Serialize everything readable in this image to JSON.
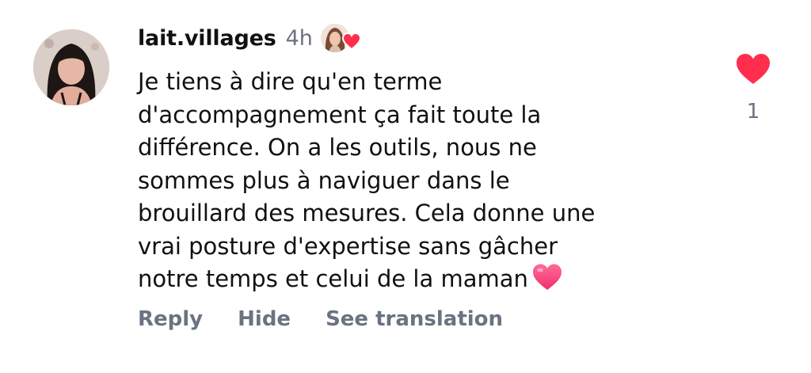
{
  "comment": {
    "username": "lait.villages",
    "time_ago": "4h",
    "text": "Je tiens à dire qu'en terme\nd'accompagnement ça fait toute la\ndifférence. On a les outils, nous ne\nsommes plus à naviguer dans le\nbrouillard des mesures. Cela donne une\nvrai posture d'expertise sans gâcher\nnotre temps et celui de la maman",
    "emoji": "pink-heart-emoji",
    "like_count": "1",
    "liked_by_author": true
  },
  "actions": {
    "reply": "Reply",
    "hide": "Hide",
    "see_translation": "See translation"
  },
  "icons": {
    "like": "heart-icon",
    "liked_by": "creator-liked-heart-icon"
  },
  "colors": {
    "like_red": "#ff2e4c",
    "secondary_text": "#6b7280"
  }
}
